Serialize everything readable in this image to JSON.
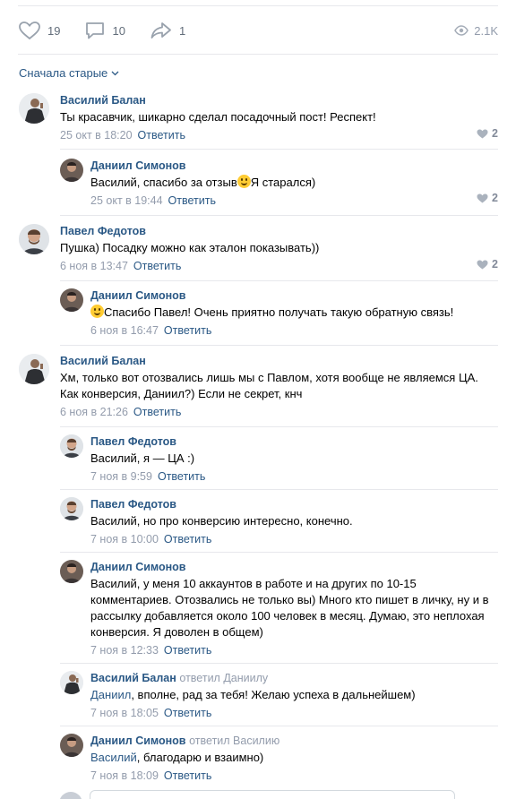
{
  "actions": {
    "likes": "19",
    "comments": "10",
    "shares": "1",
    "views": "2.1K"
  },
  "sort_label": "Сначала старые",
  "reply_label": "Ответить",
  "comments": [
    {
      "author": "Василий Балан",
      "text": "Ты красавчик, шикарно сделал посадочный пост! Респект!",
      "date": "25 окт в 18:20",
      "likes": "2"
    },
    {
      "author": "Даниил Симонов",
      "text_before": "Василий, спасибо за отзыв",
      "text_after": "Я старался)",
      "date": "25 окт в 19:44",
      "likes": "2"
    },
    {
      "author": "Павел Федотов",
      "text": "Пушка) Посадку можно как эталон показывать))",
      "date": "6 ноя в 13:47",
      "likes": "2"
    },
    {
      "author": "Даниил Симонов",
      "text_after": "Спасибо Павел! Очень приятно получать такую обратную связь!",
      "date": "6 ноя в 16:47"
    },
    {
      "author": "Василий Балан",
      "text": "Хм, только вот отозвались лишь мы с Павлом, хотя вообще не являемся ЦА. Как конверсия, Даниил?) Если не секрет, кнч",
      "date": "6 ноя в 21:26"
    },
    {
      "author": "Павел Федотов",
      "text": "Василий, я — ЦА :)",
      "date": "7 ноя в 9:59"
    },
    {
      "author": "Павел Федотов",
      "text": "Василий, но про конверсию интересно, конечно.",
      "date": "7 ноя в 10:00"
    },
    {
      "author": "Даниил Симонов",
      "text": "Василий, у меня 10 аккаунтов в работе и на других по 10-15 комментариев. Отозвались не только вы) Много кто пишет в личку, ну и в рассылку добавляется около 100 человек в месяц. Думаю, это неплохая конверсия. Я доволен в общем)",
      "date": "7 ноя в 12:33"
    },
    {
      "author": "Василий Балан",
      "reply_to": "ответил Даниилу",
      "mention": "Даниил",
      "text": ", вполне, рад за тебя! Желаю успеха в дальнейшем)",
      "date": "7 ноя в 18:05"
    },
    {
      "author": "Даниил Симонов",
      "reply_to": "ответил Василию",
      "mention": "Василий",
      "text": ", благодарю и взаимно)",
      "date": "7 ноя в 18:09"
    }
  ],
  "icons": {
    "like": "heart-icon",
    "comment": "comment-bubble-icon",
    "share": "share-arrow-icon",
    "views": "eye-icon"
  },
  "colors": {
    "link": "#2a5885",
    "meta": "#939cac",
    "icon": "#99a2ad",
    "separator": "#e7e8ec"
  }
}
